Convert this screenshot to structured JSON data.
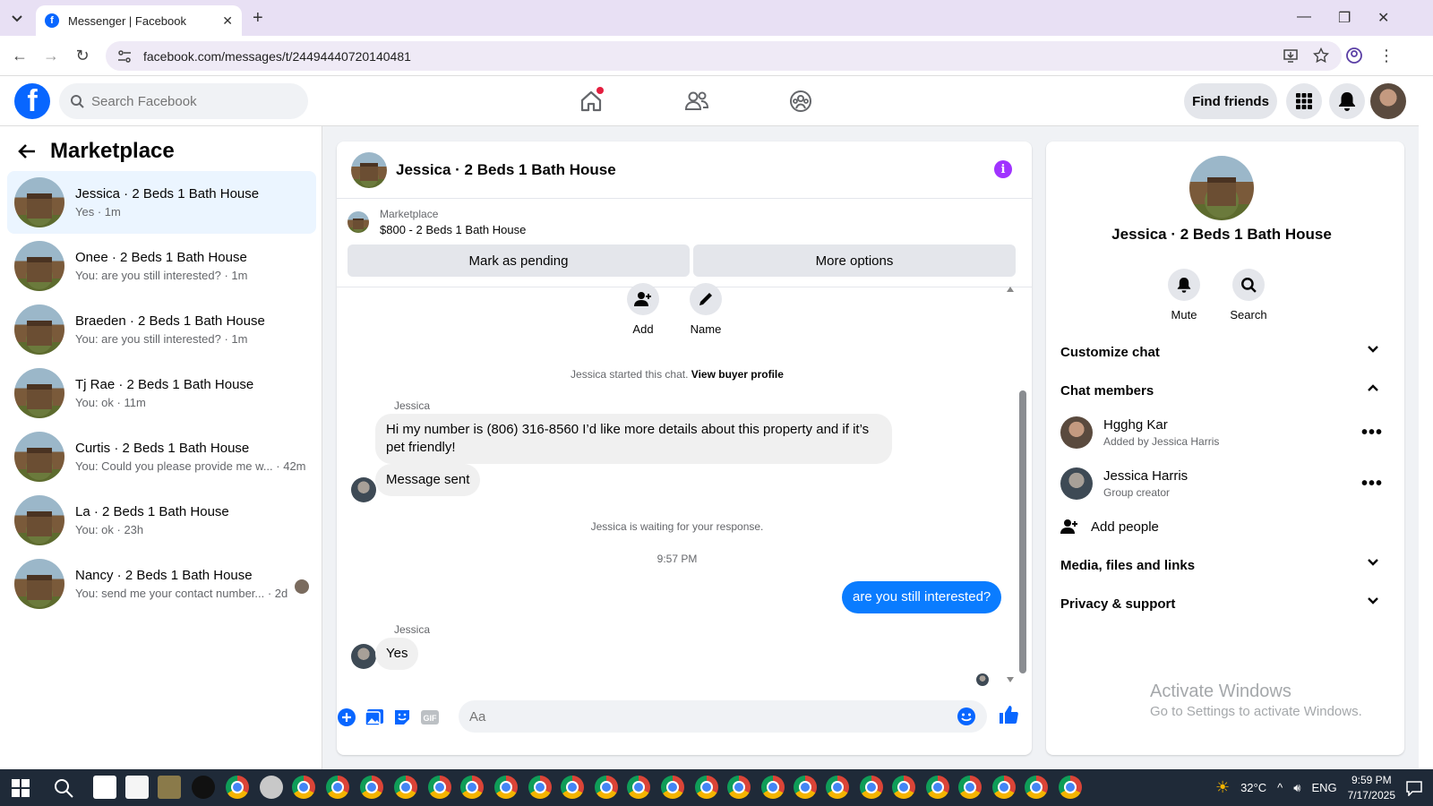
{
  "browser": {
    "tab_title": "Messenger | Facebook",
    "url": "facebook.com/messages/t/24494440720140481"
  },
  "header": {
    "search_placeholder": "Search Facebook",
    "find_friends": "Find friends"
  },
  "sidebar": {
    "title": "Marketplace",
    "conversations": [
      {
        "name": "Jessica · 2 Beds 1 Bath House",
        "preview": "Yes · 1m"
      },
      {
        "name": "Onee · 2 Beds 1 Bath House",
        "preview": "You: are you still interested? · 1m"
      },
      {
        "name": "Braeden · 2 Beds 1 Bath House",
        "preview": "You: are you still interested? · 1m"
      },
      {
        "name": "Tj Rae · 2 Beds 1 Bath House",
        "preview": "You: ok · 11m"
      },
      {
        "name": "Curtis · 2 Beds 1 Bath House",
        "preview": "You: Could you please provide me w... · 42m"
      },
      {
        "name": "La · 2 Beds 1 Bath House",
        "preview": "You: ok · 23h"
      },
      {
        "name": "Nancy · 2 Beds 1 Bath House",
        "preview": "You: send me your contact number... · 2d"
      }
    ]
  },
  "chat": {
    "title": "Jessica · 2 Beds 1 Bath House",
    "marketplace_label": "Marketplace",
    "listing": "$800 - 2 Beds 1 Bath House",
    "mark_pending": "Mark as pending",
    "more_options": "More options",
    "quick_add": "Add",
    "quick_name": "Name",
    "started_text": "Jessica started this chat.",
    "view_profile": "View buyer profile",
    "sender_name": "Jessica",
    "msg1": "Hi my number is (806) 316-8560 I’d like more details about this property and if it’s pet friendly!",
    "msg2": "Message sent",
    "waiting_text": "Jessica is waiting for your response.",
    "time_divider": "9:57 PM",
    "msg_out": "are you still interested?",
    "msg3": "Yes",
    "composer_placeholder": "Aa"
  },
  "info_panel": {
    "name": "Jessica · 2 Beds 1 Bath House",
    "mute": "Mute",
    "search": "Search",
    "customize": "Customize chat",
    "chat_members": "Chat members",
    "members": [
      {
        "name": "Hgghg Kar",
        "sub": "Added by Jessica Harris"
      },
      {
        "name": "Jessica Harris",
        "sub": "Group creator"
      }
    ],
    "add_people": "Add people",
    "media": "Media, files and links",
    "privacy": "Privacy & support"
  },
  "watermark": {
    "line1": "Activate Windows",
    "line2": "Go to Settings to activate Windows."
  },
  "taskbar": {
    "weather": "32°C",
    "lang": "ENG",
    "time": "9:59 PM",
    "date": "7/17/2025"
  },
  "colors": {
    "fb_blue": "#0866ff",
    "bubble_out": "#0a7cff",
    "info_purple": "#a033ff",
    "active_row": "#ebf5ff"
  }
}
